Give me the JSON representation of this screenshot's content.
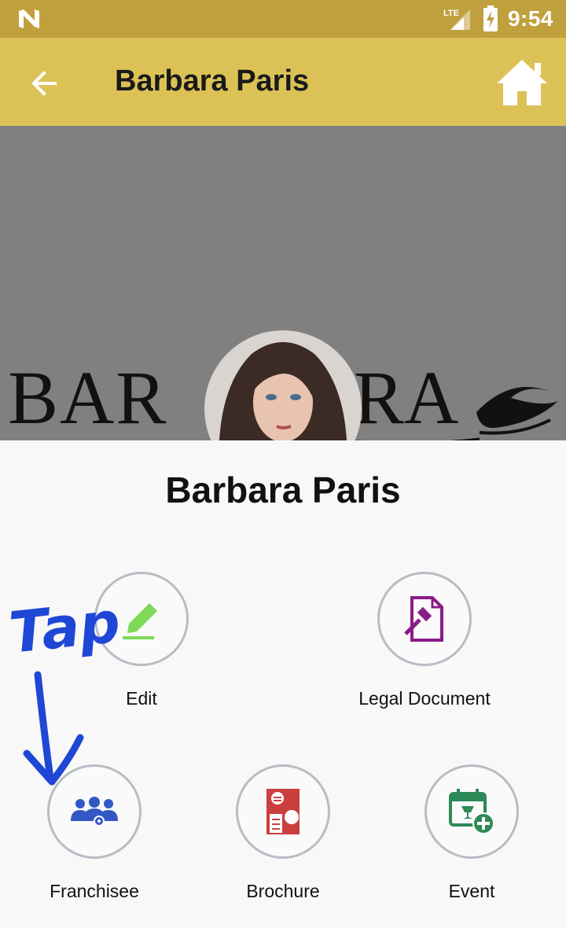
{
  "status_bar": {
    "time": "9:54",
    "network": "LTE"
  },
  "app_bar": {
    "title": "Barbara Paris"
  },
  "banner": {
    "brand_text": "BARBARA"
  },
  "profile": {
    "name": "Barbara Paris"
  },
  "actions": [
    {
      "label": "Edit"
    },
    {
      "label": "Legal Document"
    },
    {
      "label": "Franchisee"
    },
    {
      "label": "Brochure"
    },
    {
      "label": "Event"
    }
  ],
  "annotation": {
    "text": "Tap"
  },
  "colors": {
    "status_bar": "#bfa03c",
    "app_bar": "#dcc256",
    "banner": "#808080",
    "annotation": "#1f47d6"
  }
}
